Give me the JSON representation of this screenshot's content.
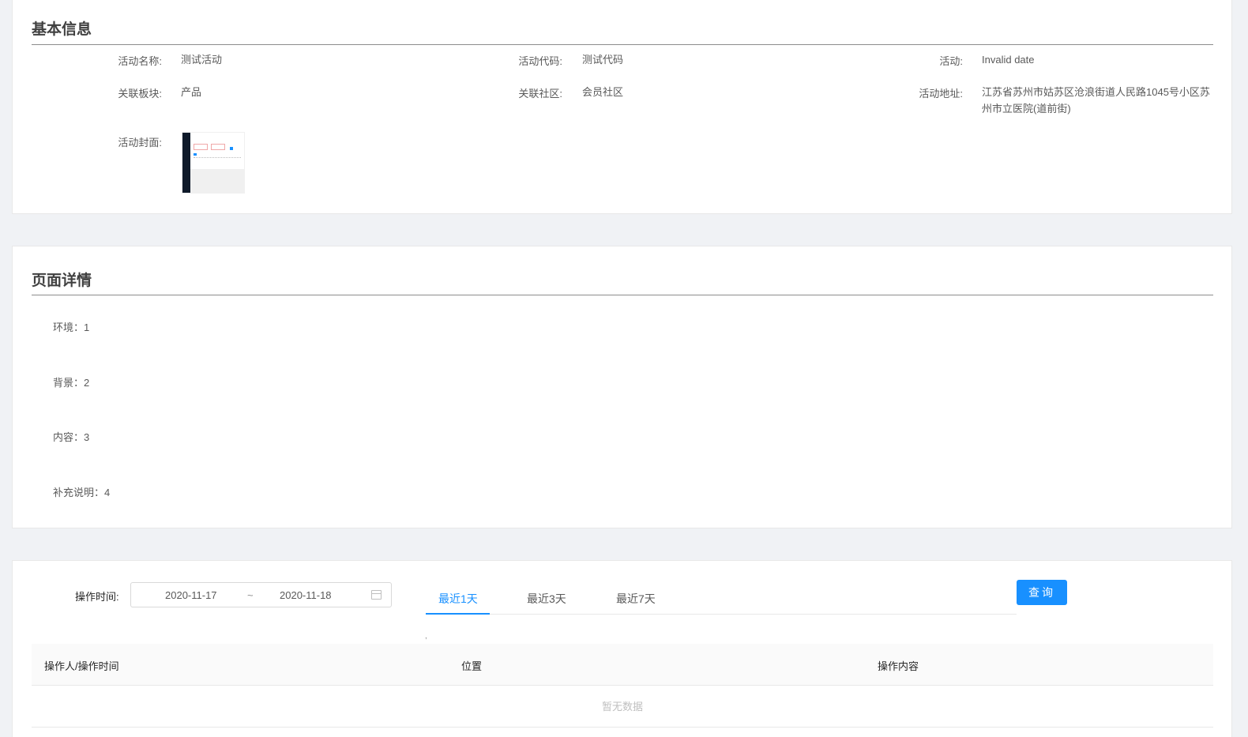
{
  "basic_info": {
    "title": "基本信息",
    "fields": [
      {
        "label": "活动名称:",
        "value": "测试活动"
      },
      {
        "label": "活动代码:",
        "value": "测试代码"
      },
      {
        "label": "活动:",
        "value": "Invalid date"
      },
      {
        "label": "关联板块:",
        "value": "产品"
      },
      {
        "label": "关联社区:",
        "value": "会员社区"
      },
      {
        "label": "活动地址:",
        "value": "江苏省苏州市姑苏区沧浪街道人民路1045号小区苏州市立医院(道前街)"
      }
    ],
    "cover_label": "活动封面:"
  },
  "page_details": {
    "title": "页面详情",
    "lines": [
      "环境：1",
      "背景：2",
      "内容：3",
      "补充说明：4"
    ]
  },
  "operation_log": {
    "time_label": "操作时间:",
    "date_start": "2020-11-17",
    "date_separator": "~",
    "date_end": "2020-11-18",
    "tabs": [
      "最近1天",
      "最近3天",
      "最近7天"
    ],
    "active_tab": "最近1天",
    "query_label": "查询",
    "stray_mark": ",",
    "columns": [
      "操作人/操作时间",
      "位置",
      "操作内容"
    ],
    "empty_text": "暂无数据"
  },
  "colors": {
    "accent": "#1890ff",
    "background": "#f0f2f5",
    "card": "#ffffff"
  }
}
